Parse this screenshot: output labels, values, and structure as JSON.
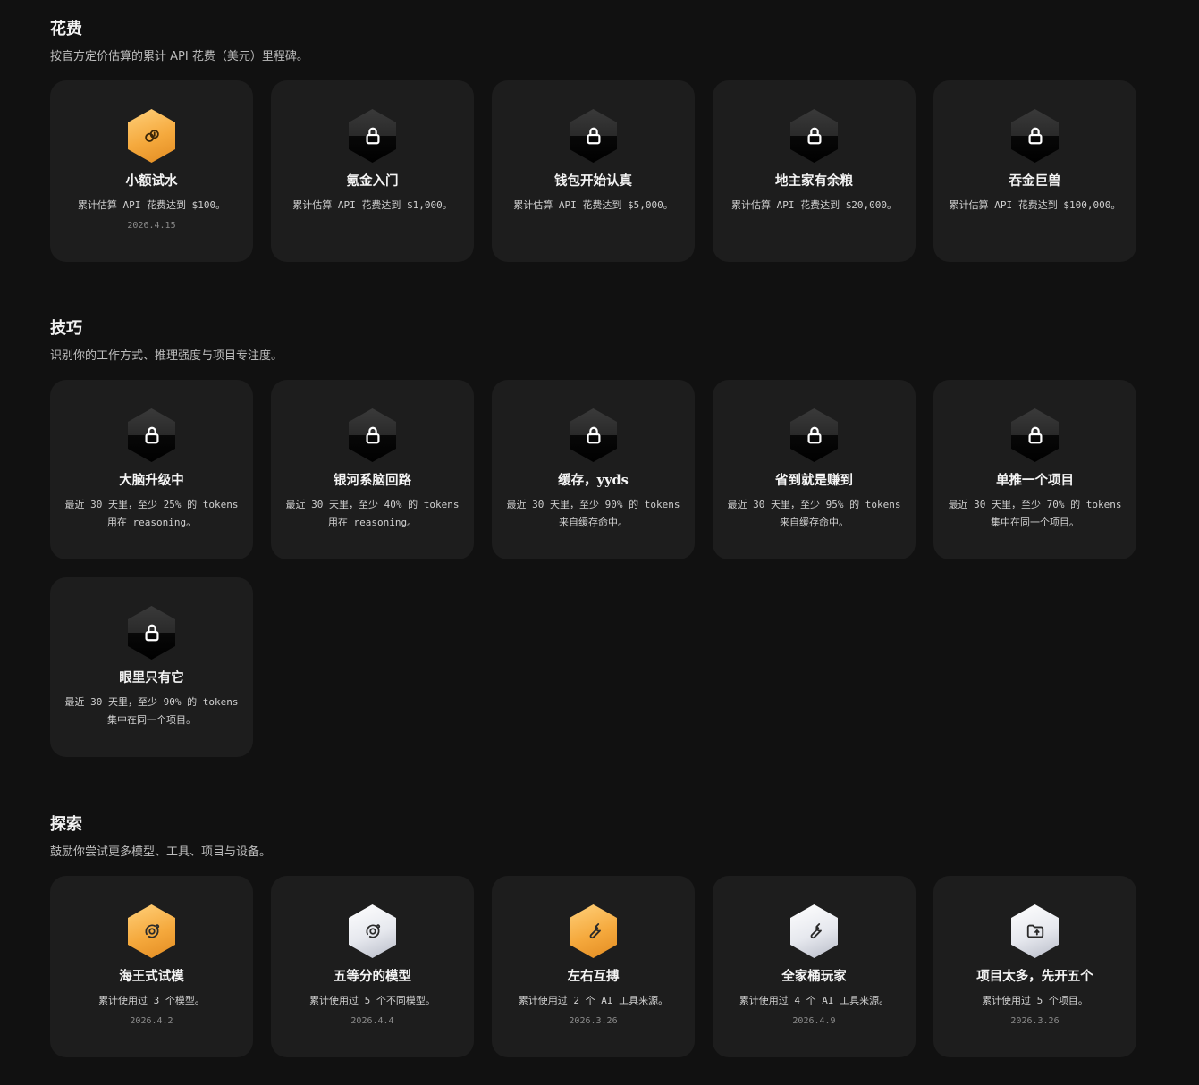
{
  "sections": [
    {
      "title": "花费",
      "description": "按官方定价估算的累计 API 花费（美元）里程碑。",
      "cards": [
        {
          "title": "小额试水",
          "desc": "累计估算 API 花费达到 $100。",
          "date": "2026.4.15",
          "icon": "coins-icon",
          "style": "gold"
        },
        {
          "title": "氪金入门",
          "desc": "累计估算 API 花费达到 $1,000。",
          "date": "",
          "icon": "lock-icon",
          "style": "locked"
        },
        {
          "title": "钱包开始认真",
          "desc": "累计估算 API 花费达到 $5,000。",
          "date": "",
          "icon": "lock-icon",
          "style": "locked"
        },
        {
          "title": "地主家有余粮",
          "desc": "累计估算 API 花费达到 $20,000。",
          "date": "",
          "icon": "lock-icon",
          "style": "locked"
        },
        {
          "title": "吞金巨兽",
          "desc": "累计估算 API 花费达到 $100,000。",
          "date": "",
          "icon": "lock-icon",
          "style": "locked"
        }
      ]
    },
    {
      "title": "技巧",
      "description": "识别你的工作方式、推理强度与项目专注度。",
      "cards": [
        {
          "title": "大脑升级中",
          "desc": "最近 30 天里，至少 25% 的 tokens 用在 reasoning。",
          "date": "",
          "icon": "lock-icon",
          "style": "locked"
        },
        {
          "title": "银河系脑回路",
          "desc": "最近 30 天里，至少 40% 的 tokens 用在 reasoning。",
          "date": "",
          "icon": "lock-icon",
          "style": "locked"
        },
        {
          "title": "缓存，yyds",
          "desc": "最近 30 天里，至少 90% 的 tokens 来自缓存命中。",
          "date": "",
          "icon": "lock-icon",
          "style": "locked"
        },
        {
          "title": "省到就是赚到",
          "desc": "最近 30 天里，至少 95% 的 tokens 来自缓存命中。",
          "date": "",
          "icon": "lock-icon",
          "style": "locked"
        },
        {
          "title": "单推一个项目",
          "desc": "最近 30 天里，至少 70% 的 tokens 集中在同一个项目。",
          "date": "",
          "icon": "lock-icon",
          "style": "locked"
        },
        {
          "title": "眼里只有它",
          "desc": "最近 30 天里，至少 90% 的 tokens 集中在同一个项目。",
          "date": "",
          "icon": "lock-icon",
          "style": "locked"
        }
      ]
    },
    {
      "title": "探索",
      "description": "鼓励你尝试更多模型、工具、项目与设备。",
      "cards": [
        {
          "title": "海王式试模",
          "desc": "累计使用过 3 个模型。",
          "date": "2026.4.2",
          "icon": "orbit-icon",
          "style": "gold"
        },
        {
          "title": "五等分的模型",
          "desc": "累计使用过 5 个不同模型。",
          "date": "2026.4.4",
          "icon": "orbit-icon",
          "style": "silver"
        },
        {
          "title": "左右互搏",
          "desc": "累计使用过 2 个 AI 工具来源。",
          "date": "2026.3.26",
          "icon": "wrench-icon",
          "style": "gold"
        },
        {
          "title": "全家桶玩家",
          "desc": "累计使用过 4 个 AI 工具来源。",
          "date": "2026.4.9",
          "icon": "wrench-icon",
          "style": "silver"
        },
        {
          "title": "项目太多，先开五个",
          "desc": "累计使用过 5 个项目。",
          "date": "2026.3.26",
          "icon": "folder-icon",
          "style": "silver"
        }
      ]
    }
  ]
}
